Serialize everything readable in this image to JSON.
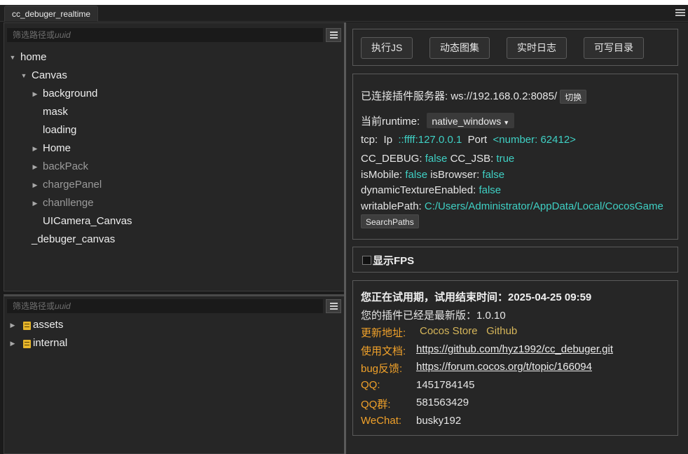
{
  "window": {
    "tab_title": "cc_debuger_realtime",
    "menu_icon": "hamburger-icon"
  },
  "scene_tree": {
    "filter_placeholder_prefix": "筛选路径或",
    "filter_placeholder_italic": "uuid",
    "nodes": [
      {
        "label": "home",
        "arrow": "▼"
      },
      {
        "label": "Canvas",
        "arrow": "▼"
      },
      {
        "label": "background",
        "arrow": "▶"
      },
      {
        "label": "mask",
        "arrow": ""
      },
      {
        "label": "loading",
        "arrow": ""
      },
      {
        "label": "Home",
        "arrow": "▶"
      },
      {
        "label": "backPack",
        "arrow": "▶"
      },
      {
        "label": "chargePanel",
        "arrow": "▶"
      },
      {
        "label": "chanllenge",
        "arrow": "▶"
      },
      {
        "label": "UICamera_Canvas",
        "arrow": ""
      },
      {
        "label": "_debuger_canvas",
        "arrow": ""
      }
    ]
  },
  "asset_tree": {
    "filter_placeholder_prefix": "筛选路径或",
    "filter_placeholder_italic": "uuid",
    "nodes": [
      {
        "label": "assets",
        "arrow": "▶"
      },
      {
        "label": "internal",
        "arrow": "▶"
      }
    ]
  },
  "toolbar": {
    "exec_js": "执行JS",
    "dynamic_atlas": "动态图集",
    "realtime_log": "实时日志",
    "writable_dir": "可写目录"
  },
  "info": {
    "server_label": "已连接插件服务器:",
    "server_url": "ws://192.168.0.2:8085/",
    "switch_btn": "切换",
    "runtime_label": "当前runtime:",
    "runtime_value": "native_windows",
    "tcp_label": "tcp:",
    "ip_label": "Ip",
    "ip_value": "::ffff:127.0.0.1",
    "port_label": "Port",
    "port_value": "<number: 62412>",
    "cc_debug_label": "CC_DEBUG:",
    "cc_debug_value": "false",
    "cc_jsb_label": "CC_JSB:",
    "cc_jsb_value": "true",
    "is_mobile_label": "isMobile:",
    "is_mobile_value": "false",
    "is_browser_label": "isBrowser:",
    "is_browser_value": "false",
    "dyn_tex_label": "dynamicTextureEnabled:",
    "dyn_tex_value": "false",
    "writable_label": "writablePath:",
    "writable_value": "C:/Users/Administrator/AppData/Local/CocosGame",
    "search_paths_btn": "SearchPaths"
  },
  "fps": {
    "label": "显示FPS",
    "checked": false
  },
  "about": {
    "trial": "您正在试用期，试用结束时间：2025-04-25 09:59",
    "version": "您的插件已经是最新版：1.0.10",
    "update_label": "更新地址:",
    "update_store": "Cocos Store",
    "update_github": "Github",
    "docs_label": "使用文档:",
    "docs_url": "https://github.com/hyz1992/cc_debuger.git",
    "bug_label": "bug反馈:",
    "bug_url": "https://forum.cocos.org/t/topic/166094",
    "qq_label": "QQ:",
    "qq_value": "1451784145",
    "qqgroup_label": "QQ群:",
    "qqgroup_value": "581563429",
    "wechat_label": "WeChat:",
    "wechat_value": "busky192"
  },
  "colors": {
    "cyan": "#3fd0c4",
    "orange": "#f0a12a",
    "yellow": "#d6b65a",
    "panel_bg": "#262626"
  }
}
